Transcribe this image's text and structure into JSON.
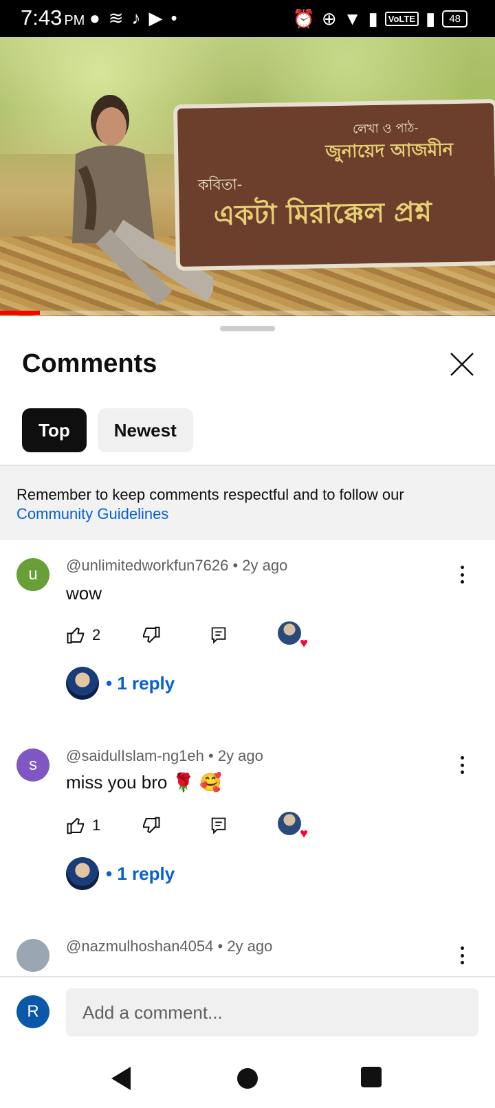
{
  "status_bar": {
    "time": "7:43",
    "ampm": "PM",
    "left_icons": [
      "messenger-icon",
      "wifi-calling-icon",
      "tiktok-icon",
      "youtube-icon"
    ],
    "right_icons": [
      "alarm-icon",
      "data-saver-icon",
      "wifi-icon",
      "signal-icon",
      "signal-icon"
    ],
    "volte": "VoLTE",
    "battery": "48"
  },
  "video": {
    "banner_line1": "লেখা ও পাঠ-",
    "banner_line2": "জুনায়েদ আজমীন",
    "banner_line3": "কবিতা-",
    "banner_line4": "একটা মিরাক্কেল প্রশ্ন",
    "progress": 0.08
  },
  "sheet": {
    "title": "Comments",
    "tabs": [
      {
        "label": "Top",
        "active": true
      },
      {
        "label": "Newest",
        "active": false
      }
    ],
    "guidelines_text": "Remember to keep comments respectful and to follow our",
    "guidelines_link": "Community Guidelines"
  },
  "comments": [
    {
      "avatar_letter": "u",
      "avatar_color": "#689f38",
      "author": "@unlimitedworkfun7626",
      "age": "2y ago",
      "text": "wow",
      "likes": "2",
      "replies": "1 reply"
    },
    {
      "avatar_letter": "s",
      "avatar_color": "#7e57c2",
      "author": "@saidulIslam-ng1eh",
      "age": "2y ago",
      "text": "miss you bro 🌹 🥰",
      "likes": "1",
      "replies": "1 reply"
    },
    {
      "avatar_letter": "",
      "avatar_color": "#9aa6b2",
      "author": "@nazmulhoshan4054",
      "age": "2y ago",
      "text": ""
    }
  ],
  "input": {
    "user_letter": "R",
    "placeholder": "Add a comment..."
  },
  "colors": {
    "link": "#065fd4",
    "heart": "#ff0033",
    "progress": "#ff0000"
  }
}
